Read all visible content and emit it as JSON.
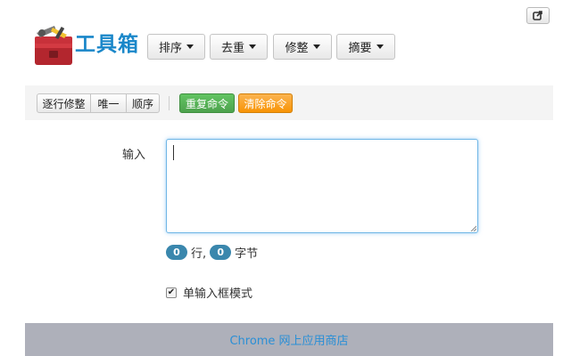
{
  "header": {
    "title": "工具箱",
    "logo_icon": "toolbox-icon",
    "corner_icon": "share-icon",
    "menus": [
      {
        "label": "排序"
      },
      {
        "label": "去重"
      },
      {
        "label": "修整"
      },
      {
        "label": "摘要"
      }
    ]
  },
  "toolbar": {
    "group": [
      "逐行修整",
      "唯一",
      "顺序"
    ],
    "repeat_label": "重复命令",
    "clear_label": "清除命令"
  },
  "input": {
    "label": "输入",
    "value": "",
    "line_count": "0",
    "line_unit": "行,",
    "byte_count": "0",
    "byte_unit": "字节"
  },
  "mode": {
    "label": "单输入框模式",
    "checked": true
  },
  "footer": {
    "link_text": "Chrome 网上应用商店"
  },
  "colors": {
    "title": "#1a87c9",
    "badge": "#3a87ad",
    "green_button": "#5bb75b",
    "orange_button": "#f89406",
    "footer_bg": "#aeb0ba",
    "footer_link": "#2a8fd6"
  }
}
